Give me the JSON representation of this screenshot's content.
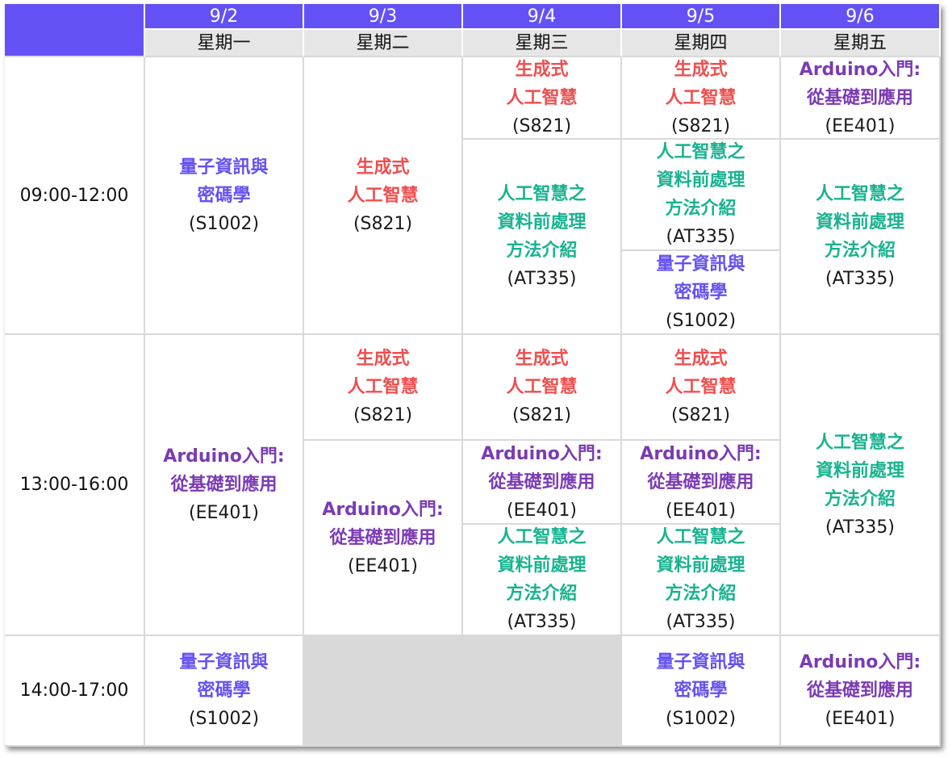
{
  "colors": {
    "header_bg": "#6451f5",
    "subheader_bg": "#e6e6e6",
    "empty_bg": "#d9d9d9",
    "course_colors": {
      "quantum": "#6451f5",
      "genai": "#f04e4e",
      "arduino": "#7b3bb3",
      "preprocess": "#18b38f"
    }
  },
  "courses": {
    "quantum": {
      "lines": [
        "量子資訊與",
        "密碼學"
      ],
      "room": "(S1002)"
    },
    "genai": {
      "lines": [
        "生成式",
        "人工智慧"
      ],
      "room": "(S821)"
    },
    "arduino": {
      "lines": [
        "Arduino入門:",
        "從基礎到應用"
      ],
      "room": "(EE401)"
    },
    "preprocess": {
      "lines": [
        "人工智慧之",
        "資料前處理",
        "方法介紹"
      ],
      "room": "(AT335)"
    }
  },
  "days": [
    {
      "date": "9/2",
      "weekday": "星期一"
    },
    {
      "date": "9/3",
      "weekday": "星期二"
    },
    {
      "date": "9/4",
      "weekday": "星期三"
    },
    {
      "date": "9/5",
      "weekday": "星期四"
    },
    {
      "date": "9/6",
      "weekday": "星期五"
    }
  ],
  "time_slots": [
    "09:00-12:00",
    "13:00-16:00",
    "14:00-17:00"
  ],
  "sessions": [
    {
      "day": "9/2",
      "time": "09:00-12:00",
      "course": "quantum"
    },
    {
      "day": "9/3",
      "time": "09:00-12:00",
      "course": "genai"
    },
    {
      "day": "9/4",
      "time": "09:00-12:00",
      "course": "genai"
    },
    {
      "day": "9/4",
      "time": "09:00-12:00",
      "course": "preprocess"
    },
    {
      "day": "9/5",
      "time": "09:00-12:00",
      "course": "genai"
    },
    {
      "day": "9/5",
      "time": "09:00-12:00",
      "course": "preprocess"
    },
    {
      "day": "9/5",
      "time": "09:00-12:00",
      "course": "quantum"
    },
    {
      "day": "9/6",
      "time": "09:00-12:00",
      "course": "arduino"
    },
    {
      "day": "9/6",
      "time": "09:00-12:00",
      "course": "preprocess"
    },
    {
      "day": "9/2",
      "time": "13:00-16:00",
      "course": "arduino"
    },
    {
      "day": "9/3",
      "time": "13:00-16:00",
      "course": "genai"
    },
    {
      "day": "9/3",
      "time": "13:00-16:00",
      "course": "arduino"
    },
    {
      "day": "9/4",
      "time": "13:00-16:00",
      "course": "genai"
    },
    {
      "day": "9/4",
      "time": "13:00-16:00",
      "course": "arduino"
    },
    {
      "day": "9/4",
      "time": "13:00-16:00",
      "course": "preprocess"
    },
    {
      "day": "9/5",
      "time": "13:00-16:00",
      "course": "genai"
    },
    {
      "day": "9/5",
      "time": "13:00-16:00",
      "course": "arduino"
    },
    {
      "day": "9/5",
      "time": "13:00-16:00",
      "course": "preprocess"
    },
    {
      "day": "9/6",
      "time": "13:00-16:00",
      "course": "preprocess"
    },
    {
      "day": "9/2",
      "time": "14:00-17:00",
      "course": "quantum"
    },
    {
      "day": "9/5",
      "time": "14:00-17:00",
      "course": "quantum"
    },
    {
      "day": "9/6",
      "time": "14:00-17:00",
      "course": "arduino"
    }
  ]
}
